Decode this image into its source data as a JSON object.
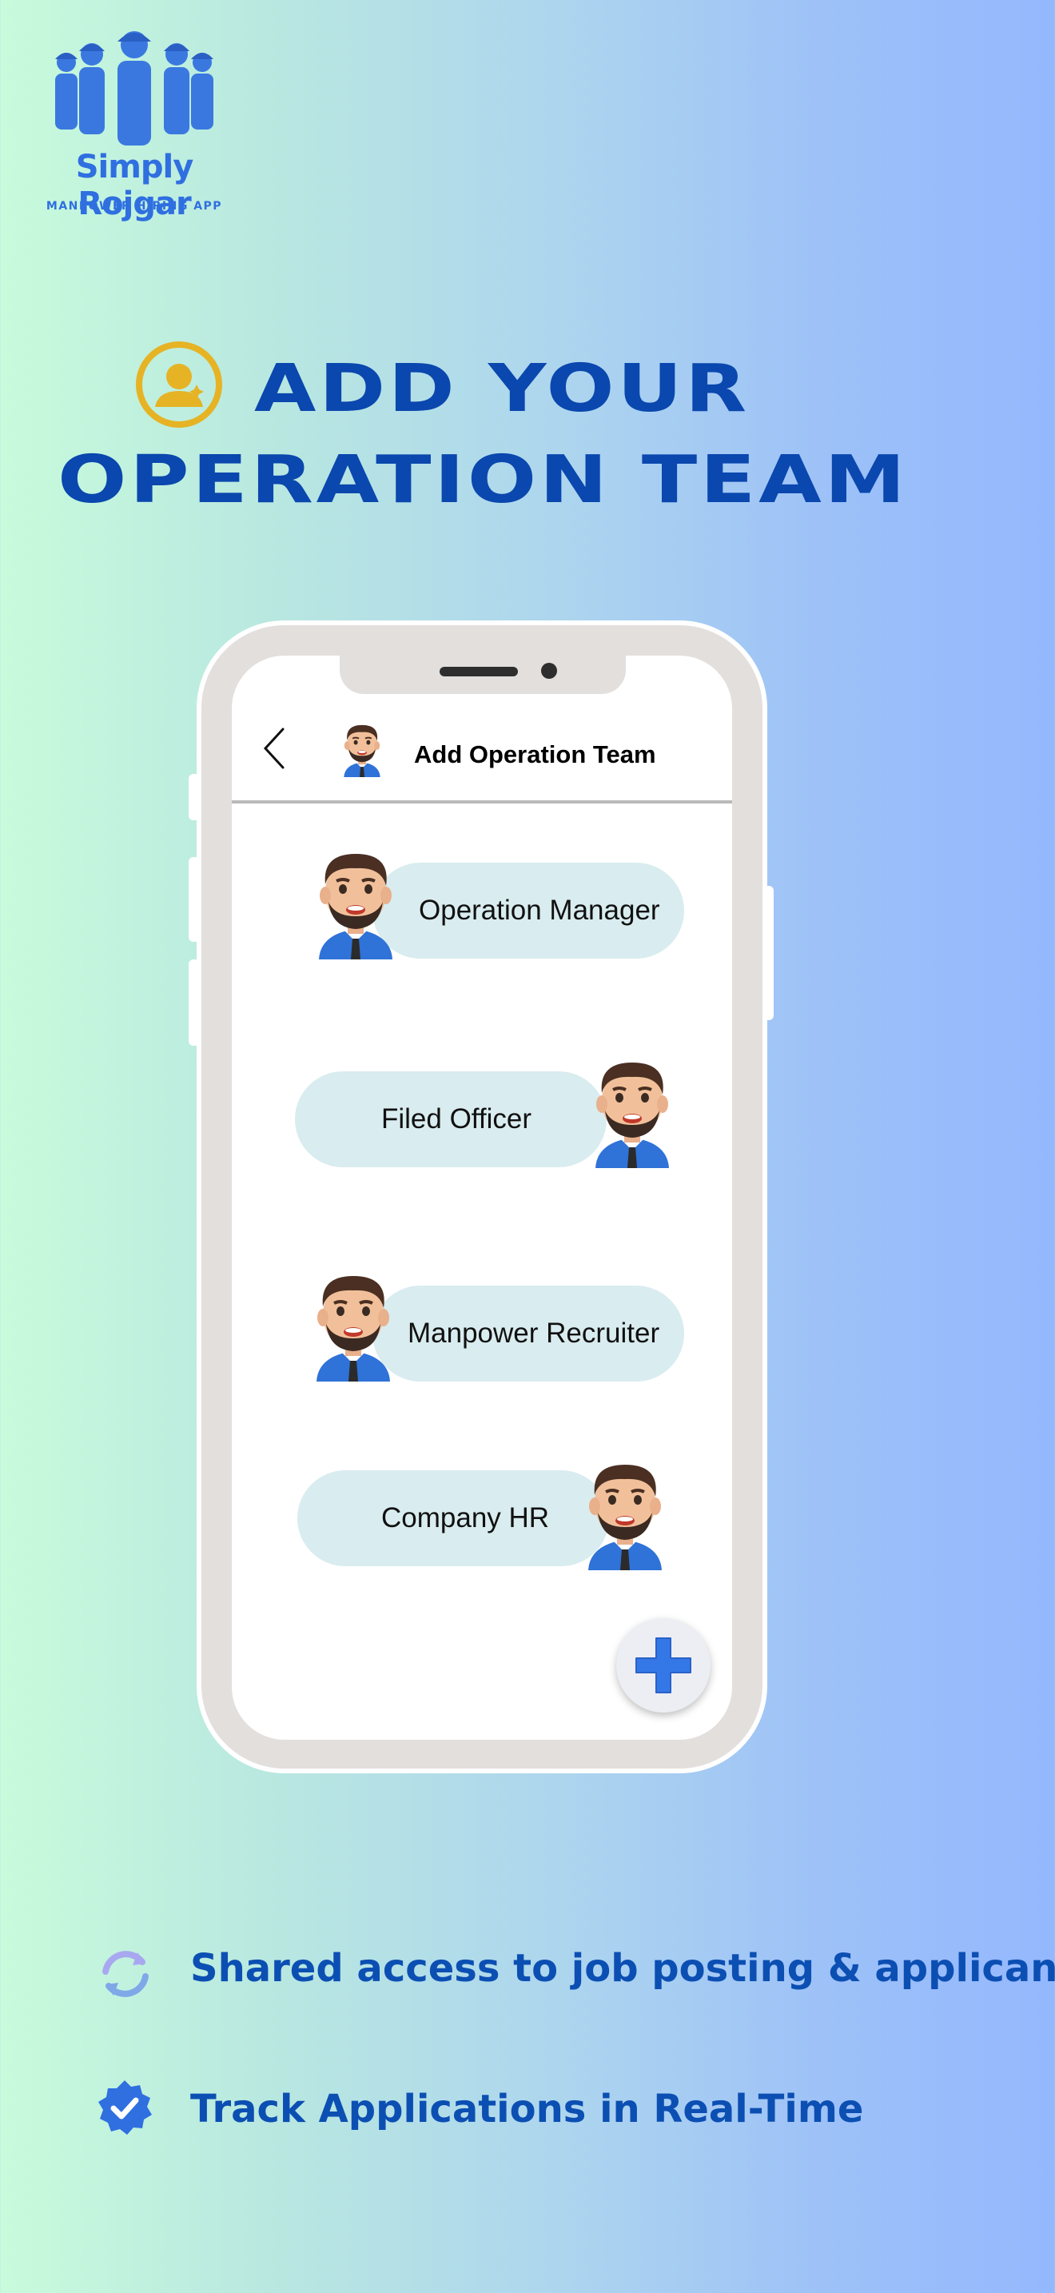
{
  "brand": {
    "name": "Simply Rojgar",
    "tagline": "MANPOWER HIRING APP"
  },
  "headline": {
    "line1": "ADD YOUR",
    "line2": "OPERATION TEAM",
    "icon": "user-badge-icon"
  },
  "app": {
    "header": {
      "back_icon": "chevron-left-icon",
      "title": "Add Operation Team"
    },
    "roles": [
      {
        "label": "Operation Manager"
      },
      {
        "label": "Filed Officer"
      },
      {
        "label": "Manpower Recruiter"
      },
      {
        "label": "Company HR"
      }
    ],
    "fab_icon": "plus-icon"
  },
  "features": [
    {
      "icon": "refresh-icon",
      "text": "Shared access to job posting & applicants"
    },
    {
      "icon": "verified-badge-icon",
      "text": "Track Applications in Real-Time"
    }
  ],
  "colors": {
    "headline": "#0a47ae",
    "brand_blue": "#2f6fe0",
    "pill": "#d9ecef",
    "plus": "#3478e8"
  }
}
